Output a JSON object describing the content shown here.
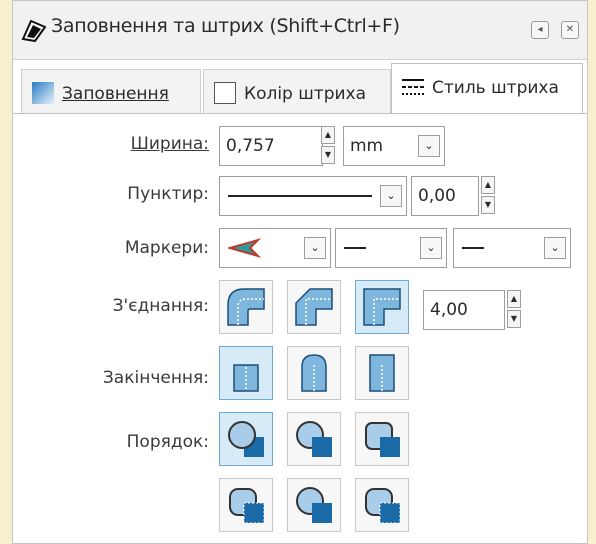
{
  "window": {
    "title": "Заповнення та штрих (Shift+Ctrl+F)",
    "btn_restore": "◂",
    "btn_close": "✕"
  },
  "tabs": [
    {
      "label": "Заповнення"
    },
    {
      "label": "Колір штриха"
    },
    {
      "label": "Стиль штриха"
    }
  ],
  "stroke_style": {
    "width": {
      "label": "Ширина:",
      "value": "0,757",
      "unit": "mm"
    },
    "dash": {
      "label": "Пунктир:",
      "offset": "0,00"
    },
    "markers": {
      "label": "Маркери:"
    },
    "join": {
      "label": "З'єднання:",
      "miter_limit": "4,00",
      "selected_index": 2
    },
    "cap": {
      "label": "Закінчення:",
      "selected_index": 0
    },
    "order": {
      "label": "Порядок:",
      "selected_index": 0
    }
  },
  "colors": {
    "accent": "#6fa9d5",
    "selected_bg": "#d6ebf7",
    "shape_fill": "#7fb6dd",
    "shape_dark": "#1a4f7a"
  }
}
